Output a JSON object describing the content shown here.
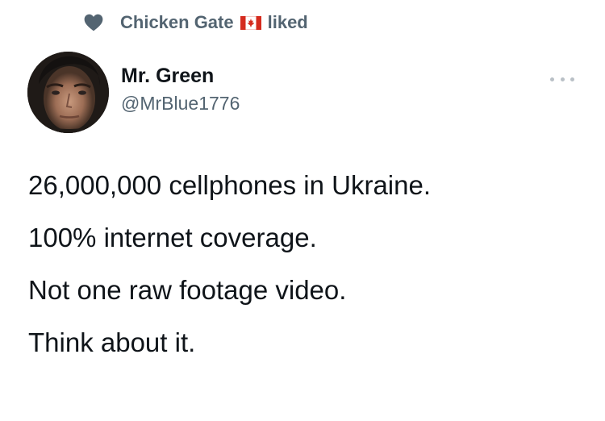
{
  "social_context": {
    "name": "Chicken Gate",
    "action": "liked",
    "flag_icon": "canada-flag-icon",
    "heart_icon": "heart-icon"
  },
  "author": {
    "display_name": "Mr. Green",
    "handle": "@MrBlue1776",
    "avatar_icon": "avatar"
  },
  "more_menu": {
    "icon": "more-options-icon"
  },
  "tweet": {
    "lines": [
      "26,000,000 cellphones in Ukraine.",
      "100% internet coverage.",
      "Not one raw footage video.",
      "Think about it."
    ]
  },
  "colors": {
    "text_primary": "#0f1419",
    "text_secondary": "#536471",
    "heart": "#536471",
    "flag_red": "#d52b1e"
  }
}
